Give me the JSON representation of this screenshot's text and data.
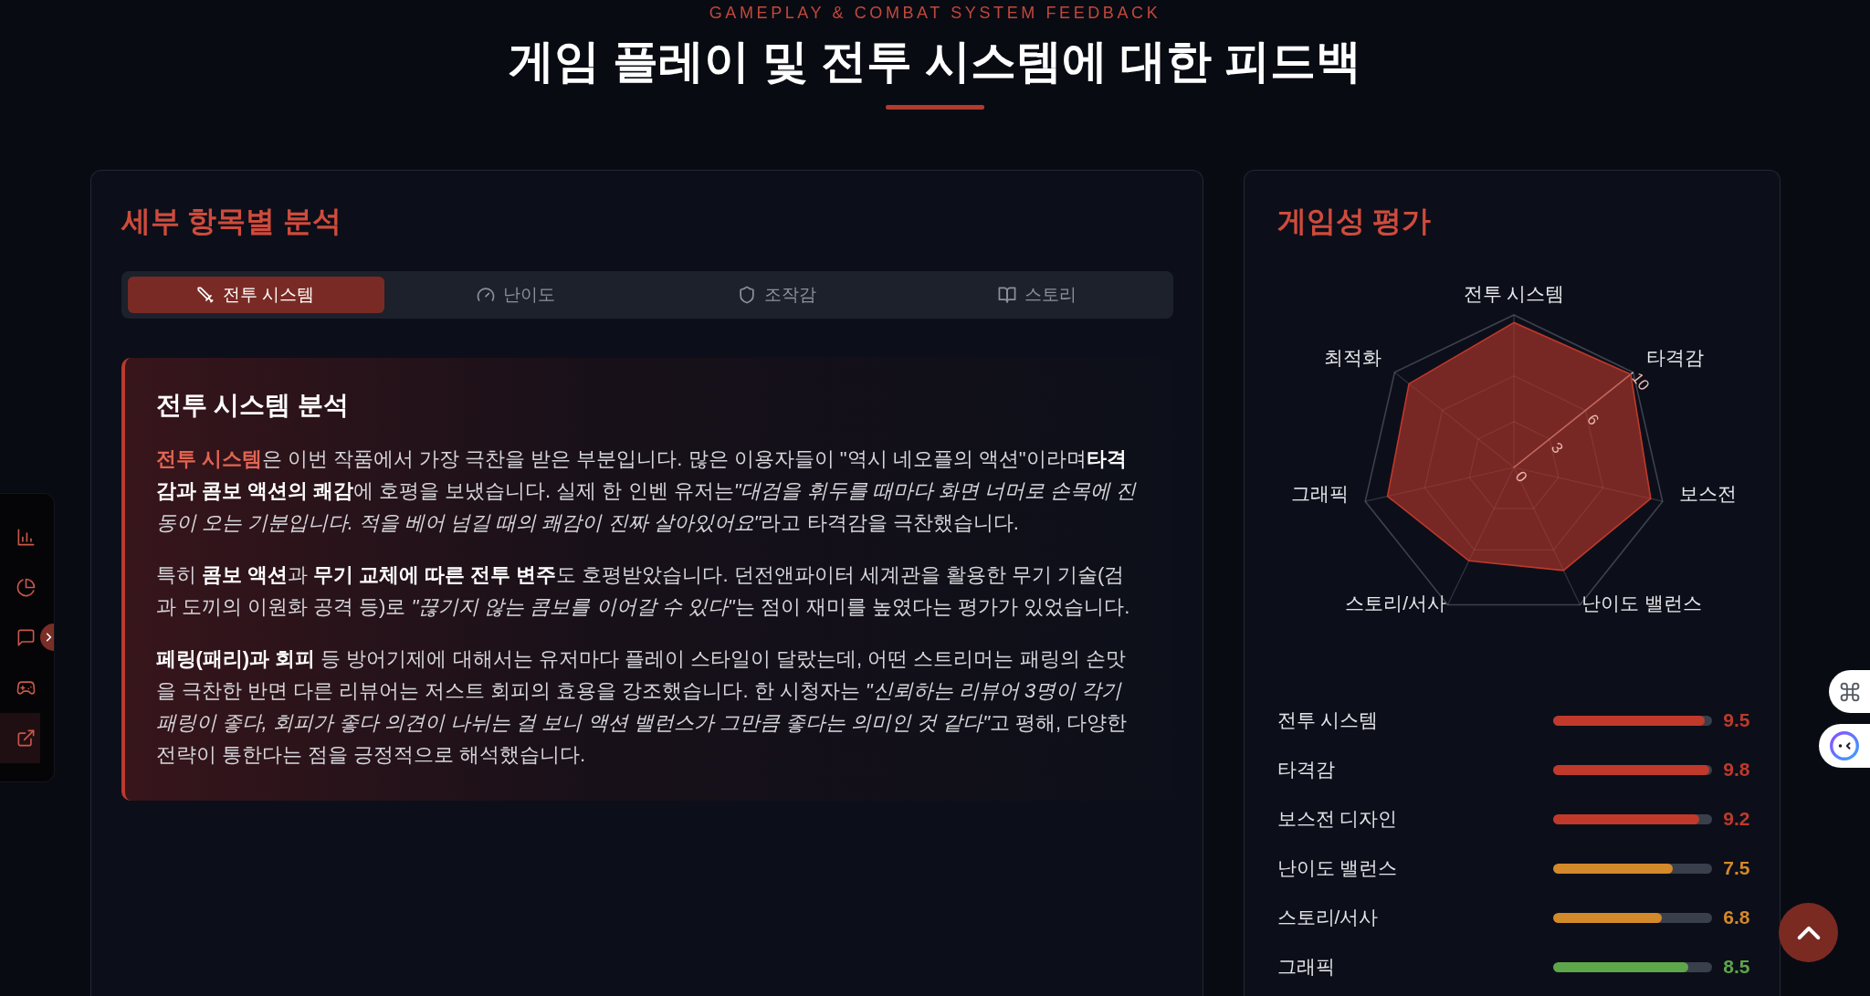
{
  "header": {
    "eyebrow": "GAMEPLAY & COMBAT SYSTEM FEEDBACK",
    "title": "게임 플레이 및 전투 시스템에 대한 피드백"
  },
  "sidebar": {
    "items": [
      {
        "selected": false
      },
      {
        "selected": false
      },
      {
        "selected": false
      },
      {
        "selected": false
      },
      {
        "selected": true
      }
    ]
  },
  "analysis": {
    "title": "세부 항목별 분석",
    "tabs": [
      {
        "label": "전투 시스템",
        "selected": true
      },
      {
        "label": "난이도",
        "selected": false
      },
      {
        "label": "조작감",
        "selected": false
      },
      {
        "label": "스토리",
        "selected": false
      }
    ],
    "panel": {
      "title": "전투 시스템 분석",
      "paragraphs": [
        {
          "runs": [
            {
              "kind": "highlight",
              "text": "전투 시스템"
            },
            {
              "kind": "plain",
              "text": "은 이번 작품에서 가장 극찬을 받은 부분입니다. 많은 이용자들이 \"역시 네오플의 액션\"이라며"
            },
            {
              "kind": "bold",
              "text": "타격감과 콤보 액션의 쾌감"
            },
            {
              "kind": "plain",
              "text": "에 호평을 보냈습니다. 실제 한 인벤 유저는"
            },
            {
              "kind": "italic",
              "text": "\"대검을 휘두를 때마다 화면 너머로 손목에 진동이 오는 기분입니다. 적을 베어 넘길 때의 쾌감이 진짜 살아있어요\""
            },
            {
              "kind": "plain",
              "text": "라고 타격감을 극찬했습니다."
            }
          ]
        },
        {
          "runs": [
            {
              "kind": "plain",
              "text": "특히 "
            },
            {
              "kind": "bold",
              "text": "콤보 액션"
            },
            {
              "kind": "plain",
              "text": "과 "
            },
            {
              "kind": "bold",
              "text": "무기 교체에 따른 전투 변주"
            },
            {
              "kind": "plain",
              "text": "도 호평받았습니다. 던전앤파이터 세계관을 활용한 무기 기술(검과 도끼의 이원화 공격 등)로 "
            },
            {
              "kind": "italic",
              "text": "\"끊기지 않는 콤보를 이어갈 수 있다\""
            },
            {
              "kind": "plain",
              "text": "는 점이 재미를 높였다는 평가가 있었습니다."
            }
          ]
        },
        {
          "runs": [
            {
              "kind": "bold",
              "text": "페링(패리)과 회피"
            },
            {
              "kind": "plain",
              "text": " 등 방어기제에 대해서는 유저마다 플레이 스타일이 달랐는데, 어떤 스트리머는 패링의 손맛을 극찬한 반면 다른 리뷰어는 저스트 회피의 효용을 강조했습니다. 한 시청자는 "
            },
            {
              "kind": "italic",
              "text": "\"신뢰하는 리뷰어 3명이 각기 패링이 좋다, 회피가 좋다 의견이 나뉘는 걸 보니 액션 밸런스가 그만큼 좋다는 의미인 것 같다\""
            },
            {
              "kind": "plain",
              "text": "고 평해, 다양한 전략이 통한다는 점을 긍정적으로 해석했습니다."
            }
          ]
        }
      ]
    }
  },
  "rating": {
    "title": "게임성 평가",
    "chart_data": {
      "type": "radar",
      "categories": [
        "전투 시스템",
        "타격감",
        "보스전",
        "난이도 밸런스",
        "스토리/서사",
        "그래픽",
        "최적화"
      ],
      "values": [
        9.5,
        9.8,
        9.2,
        7.5,
        6.8,
        8.5,
        8.8
      ],
      "ylim": [
        0,
        10
      ],
      "yticks": [
        0,
        3,
        6,
        10
      ]
    },
    "scores": [
      {
        "label": "전투 시스템",
        "level": 0.95,
        "value": "9.5",
        "color": "#c0392b"
      },
      {
        "label": "타격감",
        "level": 0.98,
        "value": "9.8",
        "color": "#c0392b"
      },
      {
        "label": "보스전 디자인",
        "level": 0.92,
        "value": "9.2",
        "color": "#c0392b"
      },
      {
        "label": "난이도 밸런스",
        "level": 0.75,
        "value": "7.5",
        "color": "#d4892a"
      },
      {
        "label": "스토리/서사",
        "level": 0.68,
        "value": "6.8",
        "color": "#d4892a"
      },
      {
        "label": "그래픽",
        "level": 0.85,
        "value": "8.5",
        "color": "#5ea64a"
      }
    ]
  }
}
